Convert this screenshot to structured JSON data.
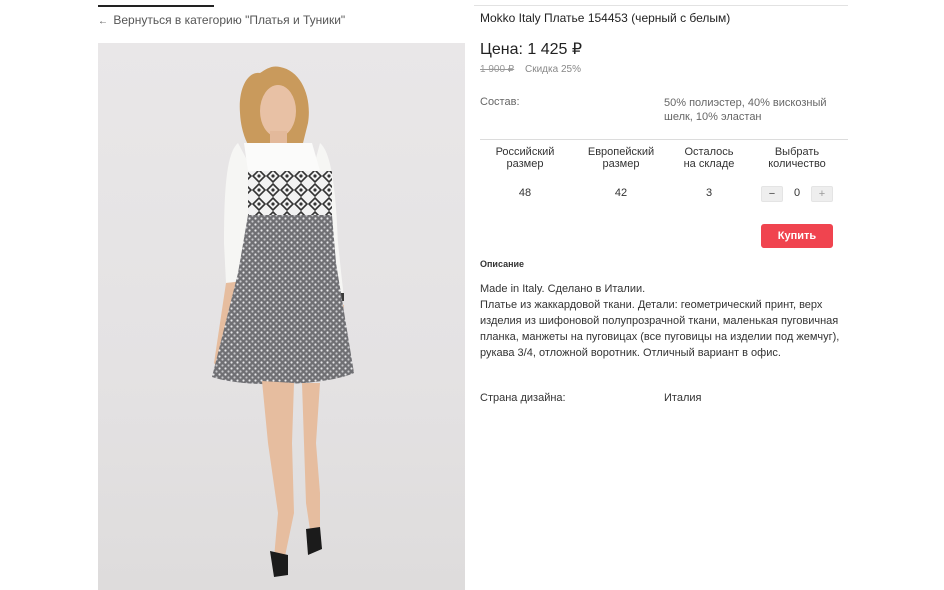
{
  "nav": {
    "back_arrow": "←",
    "back_label": "Вернуться в категорию \"Платья и Туники\""
  },
  "product": {
    "title": "Mokko Italy Платье 154453 (черный с белым)",
    "price": "Цена: 1 425 ₽",
    "old_price": "1 900 ₽",
    "discount": "Скидка 25%",
    "composition_label": "Состав:",
    "composition_value": "50% полиэстер, 40% вискозный шелк, 10% эластан"
  },
  "size_table": {
    "headers": [
      {
        "line1": "Российский",
        "line2": "размер"
      },
      {
        "line1": "Европейский",
        "line2": "размер"
      },
      {
        "line1": "Осталось",
        "line2": "на складе"
      },
      {
        "line1": "Выбрать",
        "line2": "количество"
      }
    ],
    "row": {
      "ru_size": "48",
      "eu_size": "42",
      "stock": "3"
    }
  },
  "quantity": {
    "minus": "−",
    "value": "0",
    "plus": "+"
  },
  "buy_label": "Купить",
  "description": {
    "heading": "Описание",
    "line1": "Made in Italy. Сделано в Италии.",
    "line2": "Платье из жаккардовой ткани. Детали: геометрический принт, верх изделия из шифоновой полупрозрачной ткани, маленькая пуговичная планка, манжеты на пуговицах (все пуговицы на изделии под жемчуг), рукава 3/4, отложной воротник. Отличный вариант в офис."
  },
  "country": {
    "label": "Страна дизайна:",
    "value": "Италия"
  },
  "colors": {
    "buy_button": "#f0444f",
    "text": "#222222",
    "muted": "#999999"
  }
}
